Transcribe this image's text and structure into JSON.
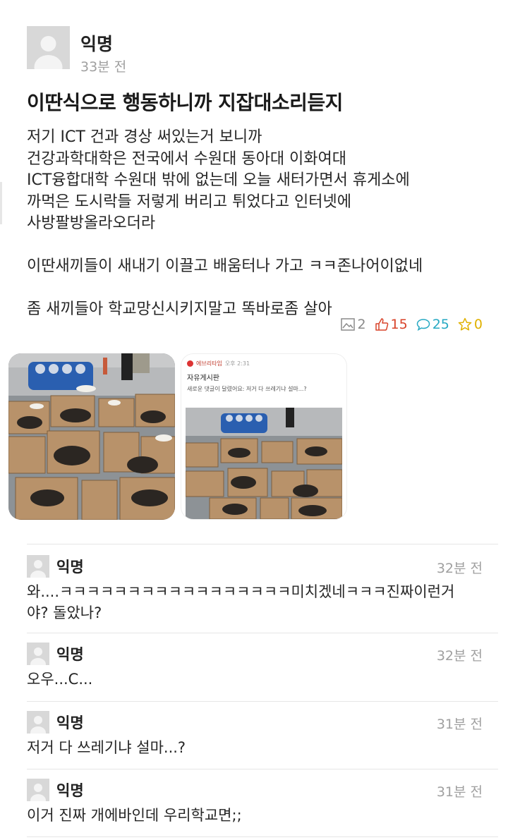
{
  "post": {
    "author": "익명",
    "time": "33분 전",
    "title": "이딴식으로 행동하니까 지잡대소리듣지",
    "body_lines": [
      "저기 ICT 건과 경상 써있는거 보니까",
      "건강과학대학은 전국에서 수원대 동아대 이화여대",
      "ICT융합대학 수원대 밖에 없는데 오늘 새터가면서 휴게소에",
      "까먹은 도시락들 저렇게 버리고 튀었다고 인터넷에",
      "사방팔방올라오더라",
      "",
      "이딴새끼들이 새내기 이끌고 배움터나 가고 ㅋㅋ존나어이없네",
      "",
      "좀 새끼들아 학교망신시키지말고 똑바로좀 살아"
    ],
    "stats": {
      "pictures": "2",
      "likes": "15",
      "comments": "25",
      "scraps": "0"
    },
    "screenshot_image": {
      "app": "에브리타임",
      "time": "오후 2:31",
      "board": "자유게시판",
      "notice": "새로운 댓글이 달렸어요: 저거 다 쓰레기냐 설마...?"
    }
  },
  "comments": [
    {
      "author": "익명",
      "time": "32분 전",
      "lines": [
        "와....ㅋㅋㅋㅋㅋㅋㅋㅋㅋㅋㅋㅋㅋㅋㅋㅋㅋ미치겠네ㅋㅋㅋ진짜이런거",
        "야? 돌았나?"
      ]
    },
    {
      "author": "익명",
      "time": "32분 전",
      "lines": [
        "오우...C..."
      ]
    },
    {
      "author": "익명",
      "time": "31분 전",
      "lines": [
        "저거 다 쓰레기냐 설마...?"
      ]
    },
    {
      "author": "익명",
      "time": "31분 전",
      "lines": [
        "이거 진짜 개에바인데 우리학교면;;"
      ]
    }
  ],
  "colors": {
    "like": "#d8432a",
    "comment": "#27a9c3",
    "scrap": "#e0b100",
    "muted": "#a0a0a0"
  },
  "icons": [
    "picture-icon",
    "thumb-up-icon",
    "speech-bubble-icon",
    "star-icon",
    "avatar-icon"
  ]
}
